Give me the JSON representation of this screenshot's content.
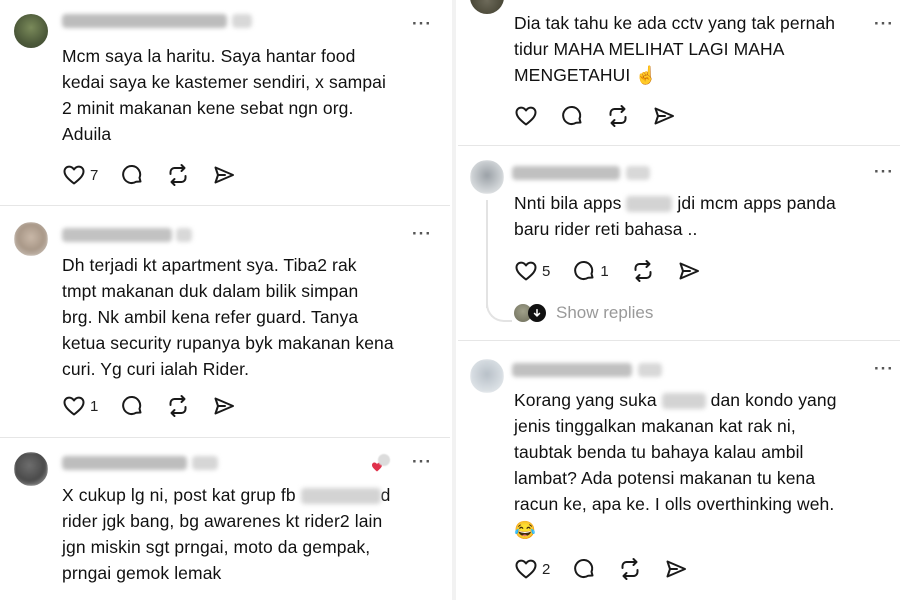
{
  "posts_left": [
    {
      "lines": [
        "Mcm saya la haritu. Saya hantar food",
        "kedai saya ke kastemer sendiri, x sampai",
        "2 minit makanan kene sebat ngn org.",
        "Aduila"
      ],
      "likes": "7"
    },
    {
      "lines": [
        "Dh terjadi kt apartment sya. Tiba2 rak",
        "tmpt makanan duk dalam bilik simpan",
        "brg. Nk ambil kena refer guard. Tanya",
        "ketua security rupanya byk makanan kena",
        "curi. Yg curi ialah Rider."
      ],
      "likes": "1"
    },
    {
      "line1": "X cukup lg ni, post kat grup fb",
      "line1_tail": "d",
      "lines": [
        "rider jgk bang, bg awarenes kt rider2 lain",
        "jgn miskin sgt prngai, moto da gempak,",
        "prngai gemok lemak"
      ]
    }
  ],
  "posts_right": [
    {
      "lines": [
        "Dia tak tahu ke ada cctv yang tak pernah",
        "tidur MAHA MELIHAT LAGI MAHA",
        "MENGETAHUI ☝"
      ]
    },
    {
      "line1_head": "Nnti bila apps",
      "line1_tail": "jdi mcm apps panda",
      "line2": "baru rider reti bahasa ..",
      "likes": "5",
      "replies": "1",
      "show_replies": "Show replies"
    },
    {
      "line1_head": "Korang yang suka",
      "line1_tail": "dan kondo yang",
      "lines": [
        "jenis tinggalkan makanan kat rak ni,",
        "taubtak benda tu bahaya kalau ambil",
        "lambat? Ada potensi makanan tu kena",
        "racun ke, apa ke. I olls overthinking weh.",
        "😂"
      ],
      "likes": "2"
    }
  ],
  "icons": [
    "heart-icon",
    "comment-icon",
    "repost-icon",
    "share-icon",
    "more-icon",
    "arrow-down-icon"
  ],
  "colors": {
    "text": "#111111",
    "muted": "#999999",
    "icon": "#1a1a1a",
    "divider": "#e6e6e6"
  }
}
